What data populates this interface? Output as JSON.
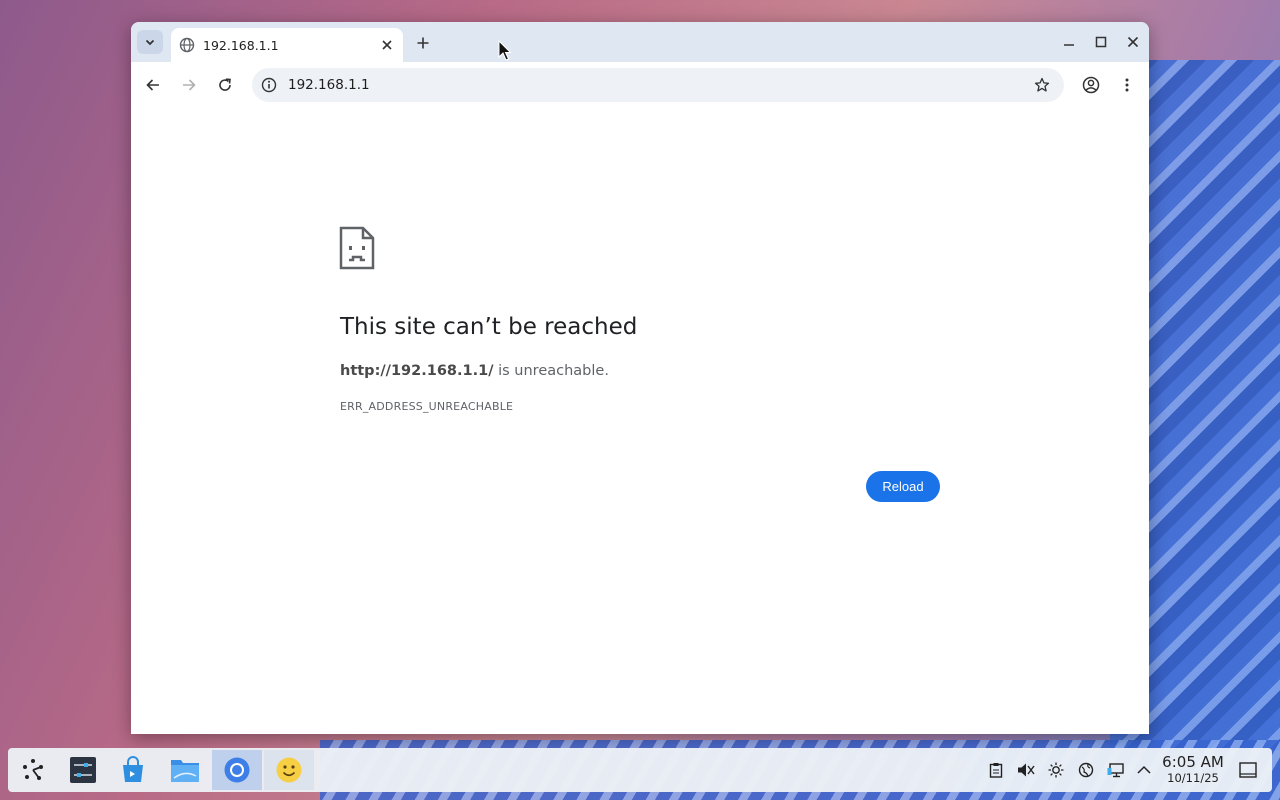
{
  "browser": {
    "tab": {
      "title": "192.168.1.1"
    },
    "omnibox": {
      "url": "192.168.1.1"
    }
  },
  "error_page": {
    "title": "This site can’t be reached",
    "url_bold": "http://192.168.1.1/",
    "message_suffix": " is unreachable.",
    "code": "ERR_ADDRESS_UNREACHABLE",
    "reload_label": "Reload"
  },
  "taskbar": {
    "apps": [
      "launcher-icon",
      "settings-icon",
      "store-icon",
      "file-manager-icon",
      "chromium-icon",
      "smiley-icon"
    ],
    "tray": [
      "clipboard-icon",
      "volume-muted-icon",
      "brightness-icon",
      "network-icon",
      "display-icon",
      "chevron-up-icon"
    ],
    "clock": {
      "time": "6:05 AM",
      "date": "10/11/25"
    }
  },
  "colors": {
    "accent": "#1a73e8",
    "titlebar": "#dfe7f3"
  }
}
